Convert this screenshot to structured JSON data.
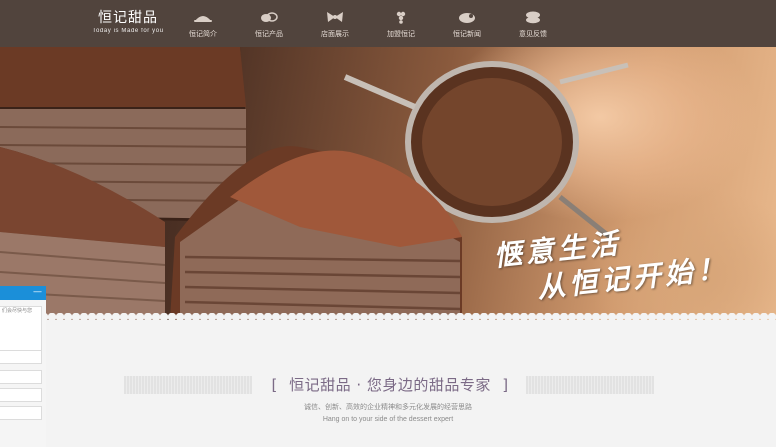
{
  "header": {
    "logo_title": "恒记甜品",
    "logo_subtitle": "Today is Made for you",
    "nav": [
      {
        "label": "恒记简介",
        "icon": "hat-icon"
      },
      {
        "label": "恒记产品",
        "icon": "cake-icon"
      },
      {
        "label": "店面展示",
        "icon": "bow-icon"
      },
      {
        "label": "加盟恒记",
        "icon": "grapes-icon"
      },
      {
        "label": "恒记新闻",
        "icon": "bowl-icon"
      },
      {
        "label": "意见反馈",
        "icon": "macaron-icon"
      }
    ]
  },
  "hero": {
    "tagline_line1": "惬意生活",
    "tagline_line2": "从恒记开始！"
  },
  "section": {
    "title_open": "[",
    "title": "恒记甜品 · 您身边的甜品专家",
    "title_close": "]",
    "subtitle_cn": "诚信、创新、高效的企业精神和多元化发展的经营思路",
    "subtitle_en": "Hang on to your side of the dessert expert"
  },
  "widget": {
    "minimize": "—",
    "message_hint": "们会尽快与您"
  },
  "colors": {
    "header_bg": "#51443d",
    "title_color": "#7b6a86",
    "widget_accent": "#1b8fd9"
  }
}
